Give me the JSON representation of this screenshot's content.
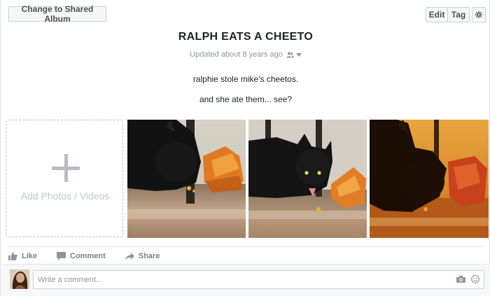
{
  "toolbar": {
    "change_album_label": "Change to Shared Album",
    "edit_label": "Edit",
    "tag_label": "Tag"
  },
  "album": {
    "title": "RALPH EATS A CHEETO",
    "updated": "Updated about 8 years ago",
    "description_line1": "ralphie stole mike's cheetos.",
    "description_line2": "and she ate them... see?"
  },
  "add_media": {
    "label": "Add Photos / Videos"
  },
  "actions": {
    "like": "Like",
    "comment": "Comment",
    "share": "Share"
  },
  "comment_box": {
    "placeholder": "Write a comment..."
  },
  "icons": {
    "settings": "gear-icon",
    "audience": "friends-icon",
    "like": "thumbs-up-icon",
    "comment": "speech-bubble-icon",
    "share": "share-arrow-icon",
    "camera": "camera-icon",
    "emoji": "smiley-icon"
  },
  "colors": {
    "border": "#dddfe2",
    "button_bg": "#f6f7f9",
    "muted_text": "#90949c",
    "action_text": "#7f7f7f"
  }
}
